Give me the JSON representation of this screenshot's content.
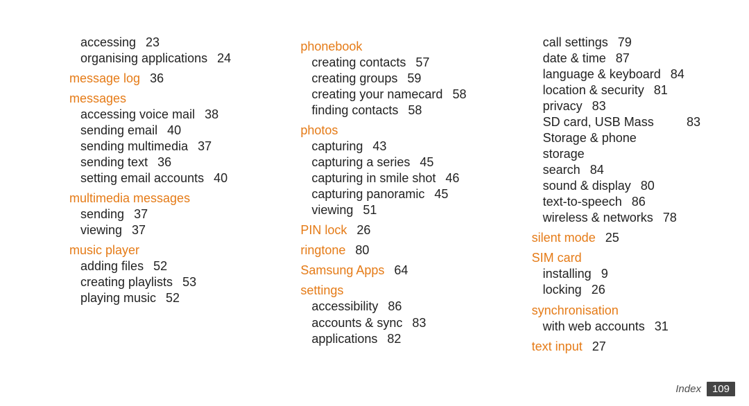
{
  "footer": {
    "label": "Index",
    "page": "109"
  },
  "columns": [
    {
      "items": [
        {
          "type": "sub",
          "label": "accessing",
          "page": "23"
        },
        {
          "type": "sub",
          "label": "organising applications",
          "page": "24"
        },
        {
          "type": "heading",
          "label": "message log",
          "page": "36"
        },
        {
          "type": "heading",
          "label": "messages"
        },
        {
          "type": "sub",
          "label": "accessing voice mail",
          "page": "38"
        },
        {
          "type": "sub",
          "label": "sending email",
          "page": "40"
        },
        {
          "type": "sub",
          "label": "sending multimedia",
          "page": "37"
        },
        {
          "type": "sub",
          "label": "sending text",
          "page": "36"
        },
        {
          "type": "sub",
          "label": "setting email accounts",
          "page": "40"
        },
        {
          "type": "heading",
          "label": "multimedia messages"
        },
        {
          "type": "sub",
          "label": "sending",
          "page": "37"
        },
        {
          "type": "sub",
          "label": "viewing",
          "page": "37"
        },
        {
          "type": "heading",
          "label": "music player"
        },
        {
          "type": "sub",
          "label": "adding files",
          "page": "52"
        },
        {
          "type": "sub",
          "label": "creating playlists",
          "page": "53"
        },
        {
          "type": "sub",
          "label": "playing music",
          "page": "52"
        }
      ]
    },
    {
      "items": [
        {
          "type": "heading",
          "label": "phonebook"
        },
        {
          "type": "sub",
          "label": "creating contacts",
          "page": "57"
        },
        {
          "type": "sub",
          "label": "creating groups",
          "page": "59"
        },
        {
          "type": "sub",
          "label": "creating your namecard",
          "page": "58"
        },
        {
          "type": "sub",
          "label": "finding contacts",
          "page": "58"
        },
        {
          "type": "heading",
          "label": "photos"
        },
        {
          "type": "sub",
          "label": "capturing",
          "page": "43"
        },
        {
          "type": "sub",
          "label": "capturing a series",
          "page": "45"
        },
        {
          "type": "sub",
          "label": "capturing in smile shot",
          "page": "46"
        },
        {
          "type": "sub",
          "label": "capturing panoramic",
          "page": "45"
        },
        {
          "type": "sub",
          "label": "viewing",
          "page": "51"
        },
        {
          "type": "heading",
          "label": "PIN lock",
          "page": "26"
        },
        {
          "type": "heading",
          "label": "ringtone",
          "page": "80"
        },
        {
          "type": "heading",
          "label": "Samsung Apps",
          "page": "64"
        },
        {
          "type": "heading",
          "label": "settings"
        },
        {
          "type": "sub",
          "label": "accessibility",
          "page": "86"
        },
        {
          "type": "sub",
          "label": "accounts & sync",
          "page": "83"
        },
        {
          "type": "sub",
          "label": "applications",
          "page": "82"
        }
      ]
    },
    {
      "items": [
        {
          "type": "sub",
          "label": "call settings",
          "page": "79"
        },
        {
          "type": "sub",
          "label": "date & time",
          "page": "87"
        },
        {
          "type": "sub",
          "label": "language & keyboard",
          "page": "84"
        },
        {
          "type": "sub",
          "label": "location & security",
          "page": "81"
        },
        {
          "type": "sub",
          "label": "privacy",
          "page": "83"
        },
        {
          "type": "sub",
          "label": "SD card, USB Mass Storage & phone storage",
          "page": "83"
        },
        {
          "type": "sub",
          "label": "search",
          "page": "84"
        },
        {
          "type": "sub",
          "label": "sound & display",
          "page": "80"
        },
        {
          "type": "sub",
          "label": "text-to-speech",
          "page": "86"
        },
        {
          "type": "sub",
          "label": "wireless & networks",
          "page": "78"
        },
        {
          "type": "heading",
          "label": "silent mode",
          "page": "25"
        },
        {
          "type": "heading",
          "label": "SIM card"
        },
        {
          "type": "sub",
          "label": "installing",
          "page": "9"
        },
        {
          "type": "sub",
          "label": "locking",
          "page": "26"
        },
        {
          "type": "heading",
          "label": "synchronisation"
        },
        {
          "type": "sub",
          "label": "with web accounts",
          "page": "31"
        },
        {
          "type": "heading",
          "label": "text input",
          "page": "27"
        }
      ]
    }
  ]
}
